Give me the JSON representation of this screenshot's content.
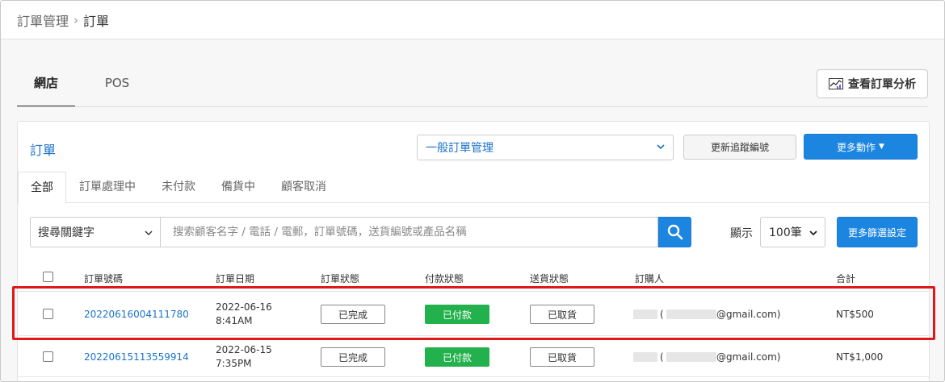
{
  "breadcrumb": {
    "parent": "訂單管理",
    "separator": "›",
    "current": "訂單"
  },
  "channel_tabs": [
    {
      "label": "網店",
      "active": true
    },
    {
      "label": "POS",
      "active": false
    }
  ],
  "analysis_button": {
    "label": "查看訂單分析",
    "icon": "chart-icon"
  },
  "panel": {
    "title": "訂單",
    "order_type": {
      "selected": "一般訂單管理"
    },
    "update_tracking_label": "更新追蹤編號",
    "more_actions_label": "更多動作"
  },
  "status_tabs": [
    {
      "label": "全部",
      "active": true
    },
    {
      "label": "訂單處理中",
      "active": false
    },
    {
      "label": "未付款",
      "active": false
    },
    {
      "label": "備貨中",
      "active": false
    },
    {
      "label": "顧客取消",
      "active": false
    }
  ],
  "search": {
    "field_selected": "搜尋關鍵字",
    "placeholder": "搜索顧客名字 / 電話 / 電郵，訂單號碼，送貨編號或產品名稱",
    "value": ""
  },
  "pagination": {
    "show_label": "顯示",
    "per_page": "100筆"
  },
  "more_filters_label": "更多篩選設定",
  "table": {
    "columns": [
      "訂單號碼",
      "訂單日期",
      "訂單狀態",
      "付款狀態",
      "送貨狀態",
      "訂購人",
      "合計"
    ],
    "rows": [
      {
        "order_no": "20220616004111780",
        "date": "2022-06-16",
        "time": "8:41AM",
        "order_status": "已完成",
        "payment_status": "已付款",
        "delivery_status": "已取貨",
        "customer_open": "(",
        "customer_email_suffix": "@gmail.com)",
        "total": "NT$500"
      },
      {
        "order_no": "20220615113559914",
        "date": "2022-06-15",
        "time": "7:35PM",
        "order_status": "已完成",
        "payment_status": "已付款",
        "delivery_status": "已取貨",
        "customer_open": "(",
        "customer_email_suffix": "@gmail.com)",
        "total": "NT$1,000"
      }
    ]
  },
  "colors": {
    "primary": "#1b85e0",
    "link": "#1a73c8",
    "paid": "#22b14c",
    "highlight": "#e01818"
  }
}
